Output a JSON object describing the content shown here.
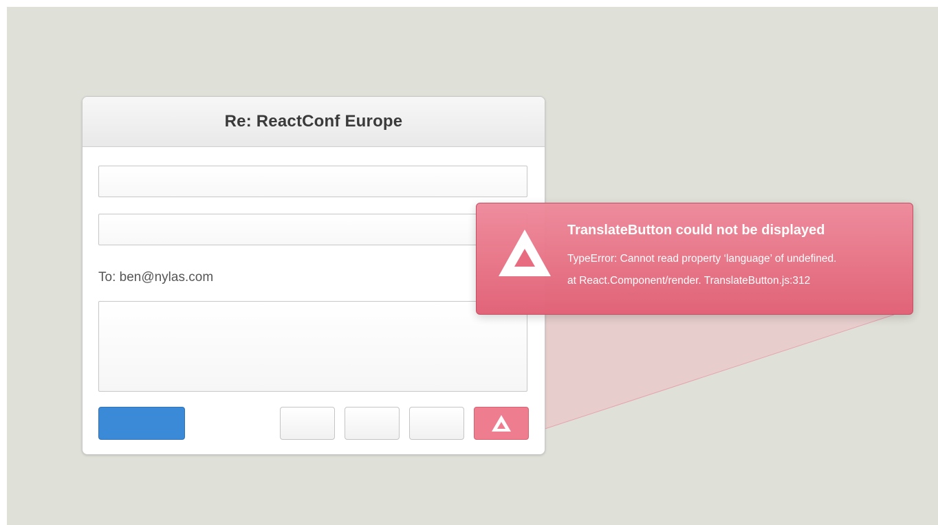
{
  "composer": {
    "title": "Re: ReactConf Europe",
    "subject_value": "",
    "cc_value": "",
    "to_label": "To: ben@nylas.com",
    "body_value": ""
  },
  "error": {
    "title": "TranslateButton could not be displayed",
    "message": "TypeError: Cannot read property ‘language’ of undefined.",
    "stack": "at React.Component/render. TranslateButton.js:312"
  },
  "icons": {
    "warning": "warning-triangle-icon"
  },
  "colors": {
    "background": "#dfe0d8",
    "send_button": "#3a8ad8",
    "error": "#e26075",
    "error_button": "#ee7d90"
  }
}
